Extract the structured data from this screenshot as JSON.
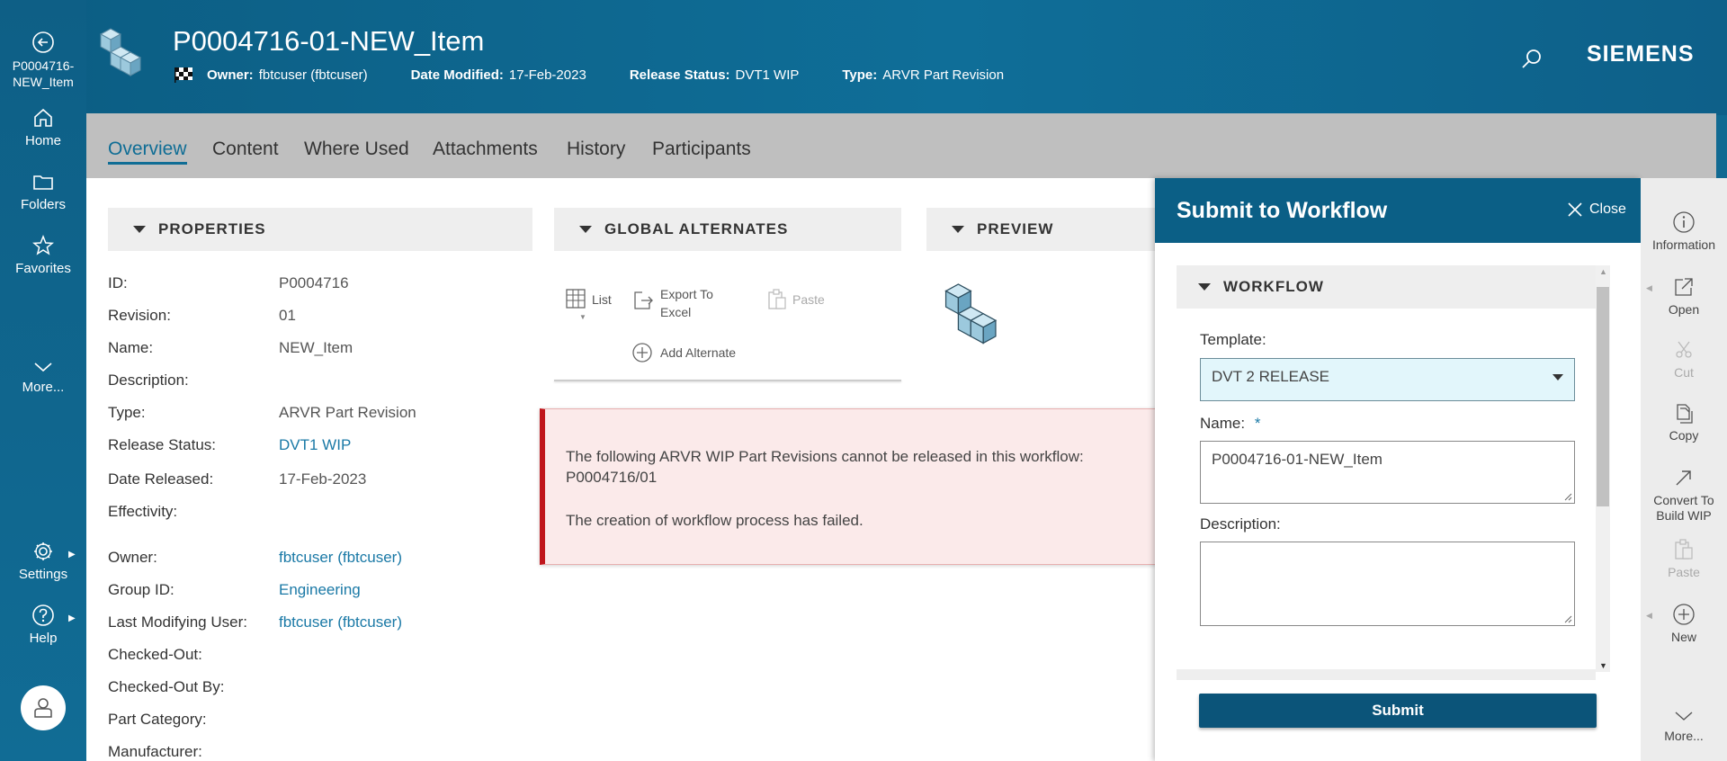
{
  "nav": {
    "back_label_line1": "P0004716-",
    "back_label_line2": "NEW_Item",
    "home": "Home",
    "folders": "Folders",
    "favorites": "Favorites",
    "more": "More...",
    "settings": "Settings",
    "help": "Help"
  },
  "header": {
    "title": "P0004716-01-NEW_Item",
    "owner_label": "Owner:",
    "owner_value": "fbtcuser (fbtcuser)",
    "date_modified_label": "Date Modified:",
    "date_modified_value": "17-Feb-2023",
    "release_status_label": "Release Status:",
    "release_status_value": "DVT1 WIP",
    "type_label": "Type:",
    "type_value": "ARVR Part Revision",
    "brand": "SIEMENS"
  },
  "tabs": [
    "Overview",
    "Content",
    "Where Used",
    "Attachments",
    "History",
    "Participants"
  ],
  "properties": {
    "title": "PROPERTIES",
    "rows": [
      {
        "k": "ID:",
        "v": "P0004716"
      },
      {
        "k": "Revision:",
        "v": "01"
      },
      {
        "k": "Name:",
        "v": "NEW_Item"
      },
      {
        "k": "Description:",
        "v": ""
      },
      {
        "k": "Type:",
        "v": "ARVR Part Revision"
      },
      {
        "k": "Release Status:",
        "v": "DVT1 WIP"
      },
      {
        "k": "Date Released:",
        "v": "17-Feb-2023"
      },
      {
        "k": "Effectivity:",
        "v": ""
      },
      {
        "k": "Owner:",
        "v": "fbtcuser (fbtcuser)"
      },
      {
        "k": "Group ID:",
        "v": "Engineering"
      },
      {
        "k": "Last Modifying User:",
        "v": "fbtcuser (fbtcuser)"
      },
      {
        "k": "Checked-Out:",
        "v": ""
      },
      {
        "k": "Checked-Out By:",
        "v": ""
      },
      {
        "k": "Part Category:",
        "v": ""
      },
      {
        "k": "Manufacturer:",
        "v": ""
      }
    ]
  },
  "alternates": {
    "title": "GLOBAL ALTERNATES",
    "list": "List",
    "export_line1": "Export To",
    "export_line2": "Excel",
    "paste": "Paste",
    "add": "Add Alternate"
  },
  "preview": {
    "title": "PREVIEW"
  },
  "error": {
    "line1": "The following ARVR WIP Part Revisions cannot be released in this workflow:",
    "line2": "P0004716/01",
    "line3": "The creation of workflow process has failed."
  },
  "workflow": {
    "title": "Submit to Workflow",
    "close": "Close",
    "section": "WORKFLOW",
    "template_label": "Template:",
    "template_value": "DVT 2 RELEASE",
    "name_label": "Name:",
    "required_mark": "*",
    "name_value": "P0004716-01-NEW_Item",
    "description_label": "Description:",
    "description_value": "",
    "submit": "Submit"
  },
  "righttools": {
    "information": "Information",
    "open": "Open",
    "cut": "Cut",
    "copy": "Copy",
    "convert_line1": "Convert To",
    "convert_line2": "Build WIP",
    "paste": "Paste",
    "new": "New",
    "more": "More..."
  }
}
